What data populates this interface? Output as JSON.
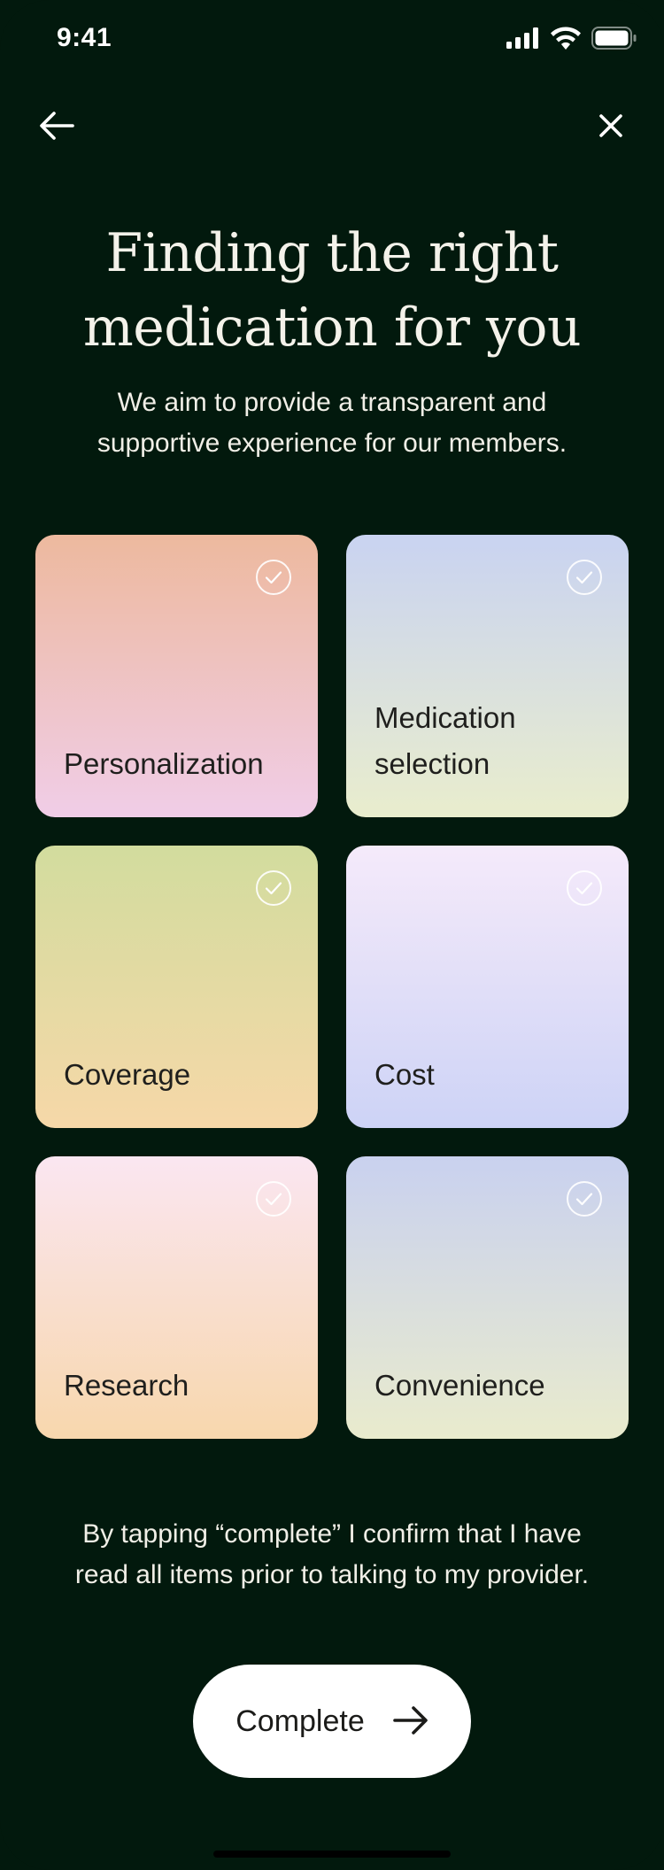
{
  "status_bar": {
    "time": "9:41",
    "icons": [
      "cellular-signal-icon",
      "wifi-icon",
      "battery-icon"
    ]
  },
  "nav": {
    "back_icon": "arrow-left-icon",
    "close_icon": "close-icon"
  },
  "header": {
    "title_line1": "Finding the right",
    "title_line2": "medication for you",
    "subtitle_line1": "We aim to provide a transparent and",
    "subtitle_line2": "supportive experience for our members."
  },
  "cards": [
    {
      "label": "Personalization",
      "checked": true
    },
    {
      "label": "Medication selection",
      "checked": true
    },
    {
      "label": "Coverage",
      "checked": true
    },
    {
      "label": "Cost",
      "checked": true
    },
    {
      "label": "Research",
      "checked": true
    },
    {
      "label": "Convenience",
      "checked": true
    }
  ],
  "disclaimer": {
    "line1": "By tapping “complete” I confirm that I have",
    "line2": "read all items prior to talking to my provider."
  },
  "complete_button": {
    "label": "Complete",
    "icon": "arrow-right-icon"
  },
  "colors": {
    "background": "#02190d",
    "text_light": "#f3f1ea",
    "button_bg": "#ffffff"
  }
}
